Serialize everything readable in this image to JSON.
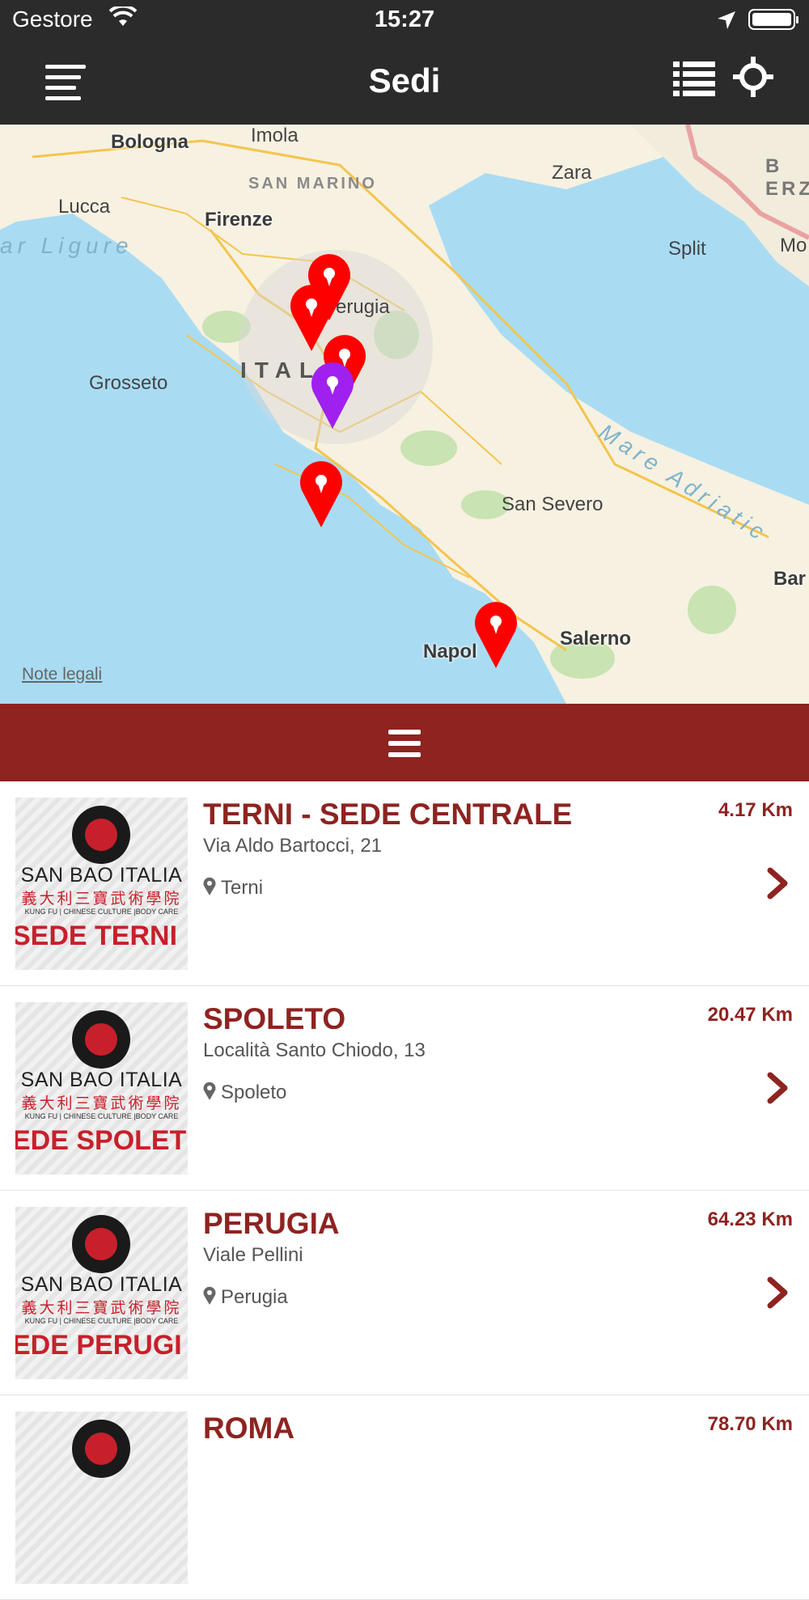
{
  "status_bar": {
    "carrier": "Gestore",
    "time": "15:27"
  },
  "nav": {
    "title": "Sedi",
    "menu_icon": "menu-icon",
    "list_icon": "list-icon",
    "locate_icon": "crosshair-icon"
  },
  "map": {
    "labels": {
      "bologna": "Bologna",
      "imola": "Imola",
      "san_marino": "SAN MARINO",
      "zara": "Zara",
      "lucca": "Lucca",
      "firenze": "Firenze",
      "mar_ligure": "ar Ligure",
      "split": "Split",
      "perugia": "erugia",
      "grosseto": "Grosseto",
      "italia": "ITAL",
      "mare_adriatico": "Mare Adriatic",
      "san_severo": "San Severo",
      "napoli": "Napol",
      "salerno": "Salerno",
      "bar": "Bar",
      "mo": "Mo",
      "erz": "B\nERZ"
    },
    "legal": "Note legali",
    "pin_colors": {
      "location": "#ff0000",
      "current": "#a020f0"
    }
  },
  "toggle": {
    "icon": "hamburger-icon"
  },
  "colors": {
    "accent": "#8e2320",
    "header": "#2b2b2b"
  },
  "locations": [
    {
      "name": "TERNI - SEDE CENTRALE",
      "address": "Via Aldo Bartocci, 21",
      "city": "Terni",
      "distance": "4.17 Km",
      "thumb": {
        "brand": "SAN BAO ITALIA",
        "cn": "義大利三寶武術學院",
        "tag": "KUNG FU | CHINESE CULTURE |BODY CARE",
        "sede": "SEDE TERNI"
      }
    },
    {
      "name": "SPOLETO",
      "address": "Località Santo Chiodo, 13",
      "city": "Spoleto",
      "distance": "20.47 Km",
      "thumb": {
        "brand": "SAN BAO ITALIA",
        "cn": "義大利三寶武術學院",
        "tag": "KUNG FU | CHINESE CULTURE |BODY CARE",
        "sede": "EDE SPOLET"
      }
    },
    {
      "name": "PERUGIA",
      "address": "Viale Pellini",
      "city": "Perugia",
      "distance": "64.23 Km",
      "thumb": {
        "brand": "SAN BAO ITALIA",
        "cn": "義大利三寶武術學院",
        "tag": "KUNG FU | CHINESE CULTURE |BODY CARE",
        "sede": "EDE PERUGI"
      }
    },
    {
      "name": "ROMA",
      "address": "",
      "city": "",
      "distance": "78.70 Km",
      "thumb": {
        "brand": "",
        "cn": "",
        "tag": "",
        "sede": ""
      }
    }
  ]
}
